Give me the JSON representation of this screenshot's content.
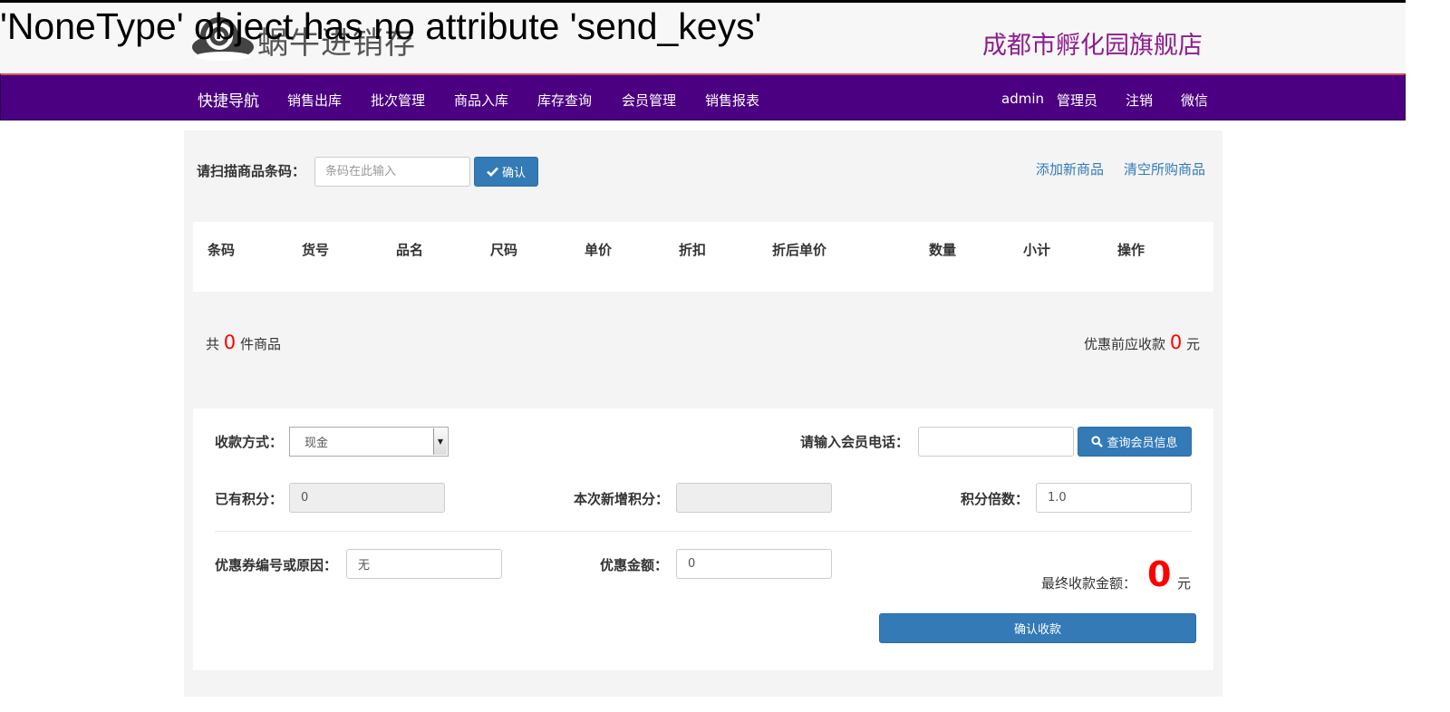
{
  "error_message": "'NoneType' object has no attribute 'send_keys'",
  "logo": {
    "text": "蜗牛进销存",
    "icon": "snail-logo-icon"
  },
  "shop_name": "成都市孵化园旗舰店",
  "nav": {
    "brand": "快捷导航",
    "items": [
      "销售出库",
      "批次管理",
      "商品入库",
      "库存查询",
      "会员管理",
      "销售报表"
    ],
    "user": "admin",
    "role": "管理员",
    "logout": "注销",
    "wechat": "微信"
  },
  "scan": {
    "label": "请扫描商品条码：",
    "placeholder": "条码在此输入",
    "confirm_label": "确认",
    "confirm_icon": "check-icon"
  },
  "links": {
    "add_product": "添加新商品",
    "clear_cart": "清空所购商品"
  },
  "table": {
    "headers": [
      "条码",
      "货号",
      "品名",
      "尺码",
      "单价",
      "折扣",
      "折后单价",
      "数量",
      "小计",
      "操作"
    ],
    "rows": []
  },
  "summary": {
    "count_prefix": "共",
    "count": "0",
    "count_suffix": "件商品",
    "prepay_label": "优惠前应收款",
    "prepay_value": "0",
    "prepay_unit": "元"
  },
  "payment": {
    "method_label": "收款方式：",
    "method_value": "现金",
    "member_phone_label": "请输入会员电话：",
    "member_phone_value": "",
    "query_member_label": "查询会员信息",
    "query_member_icon": "search-icon",
    "existing_points_label": "已有积分：",
    "existing_points_value": "0",
    "new_points_label": "本次新增积分：",
    "new_points_value": "",
    "multiplier_label": "积分倍数：",
    "multiplier_value": "1.0",
    "coupon_label": "优惠券编号或原因：",
    "coupon_value": "无",
    "discount_label": "优惠金额：",
    "discount_value": "0",
    "final_label": "最终收款金额：",
    "final_value": "0",
    "final_unit": "元",
    "submit_label": "确认收款"
  },
  "colors": {
    "navbar": "#4b0082",
    "primary": "#337ab7",
    "shop_name": "#8e1d8e",
    "alert_red": "#ff0000"
  }
}
